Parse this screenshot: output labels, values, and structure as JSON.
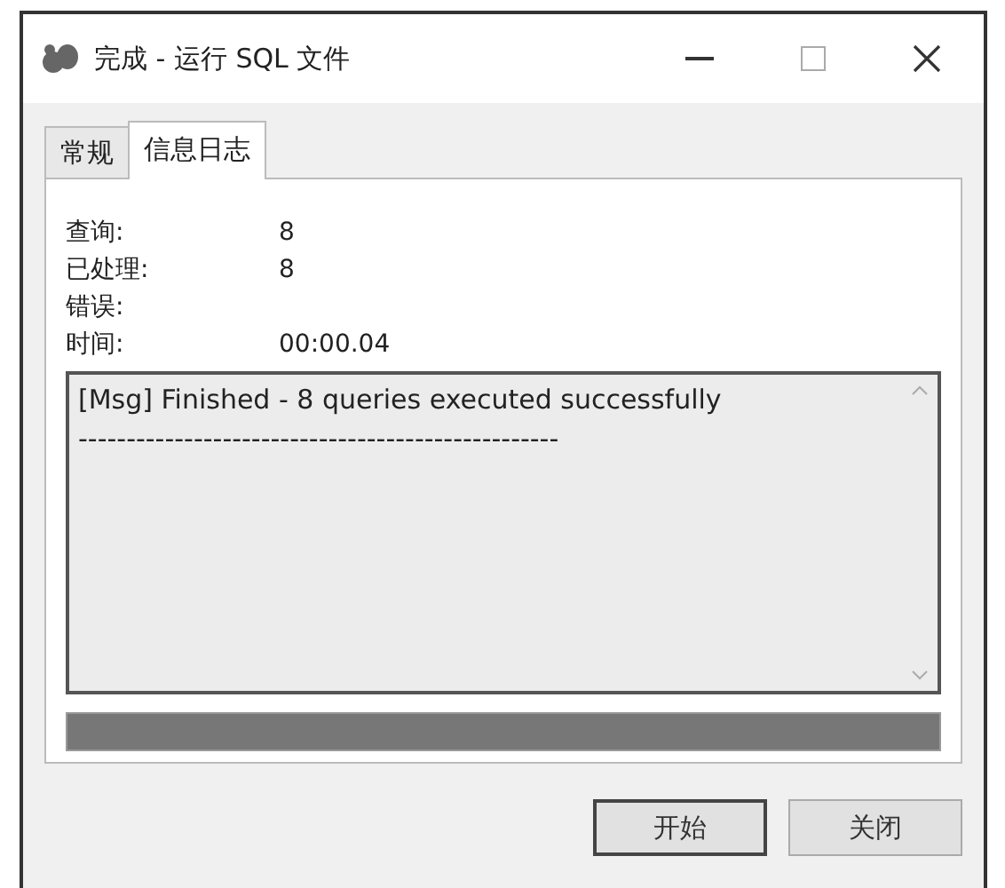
{
  "window": {
    "title": "完成 - 运行 SQL 文件"
  },
  "tabs": [
    {
      "label": "常规",
      "selected": false
    },
    {
      "label": "信息日志",
      "selected": true
    }
  ],
  "stats": [
    {
      "label": "查询:",
      "value": "8"
    },
    {
      "label": "已处理:",
      "value": "8"
    },
    {
      "label": "错误:"
    },
    {
      "label": "时间:",
      "value": "00:00.04"
    }
  ],
  "log": {
    "lines": [
      "[Msg] Finished - 8 queries executed successfully",
      "--------------------------------------------------"
    ]
  },
  "progress": {
    "level": 1
  },
  "buttons": [
    {
      "label": "开始",
      "default": true
    },
    {
      "label": "关闭",
      "default": false
    }
  ]
}
